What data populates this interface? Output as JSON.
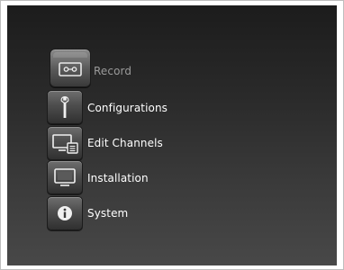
{
  "menu": {
    "items": [
      {
        "label": "Record",
        "icon": "cassette-icon",
        "state": "selected"
      },
      {
        "label": "Configurations",
        "icon": "wrench-icon"
      },
      {
        "label": "Edit Channels",
        "icon": "tv-edit-icon"
      },
      {
        "label": "Installation",
        "icon": "monitor-icon"
      },
      {
        "label": "System",
        "icon": "info-icon"
      }
    ]
  },
  "colors": {
    "background_top": "#1c1c1c",
    "background_bottom": "#484848",
    "label_text": "#ffffff",
    "selected_label_text": "#9a9a9a",
    "tile": "#4d4d4d"
  }
}
